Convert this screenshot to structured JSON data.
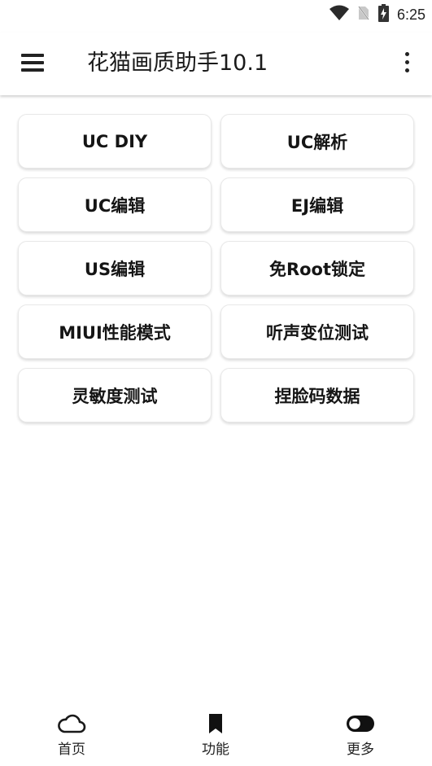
{
  "status_bar": {
    "time": "6:25",
    "icons": [
      "wifi-icon",
      "no-sim-icon",
      "battery-charging-icon"
    ]
  },
  "app_bar": {
    "title": "花猫画质助手10.1",
    "menu_icon": "hamburger-menu-icon",
    "overflow_icon": "more-vertical-icon"
  },
  "buttons": [
    {
      "label": "UC DIY"
    },
    {
      "label": "UC解析"
    },
    {
      "label": "UC编辑"
    },
    {
      "label": "EJ编辑"
    },
    {
      "label": "US编辑"
    },
    {
      "label": "免Root锁定"
    },
    {
      "label": "MIUI性能模式"
    },
    {
      "label": "听声变位测试"
    },
    {
      "label": "灵敏度测试"
    },
    {
      "label": "捏脸码数据"
    }
  ],
  "bottom_nav": {
    "items": [
      {
        "label": "首页",
        "icon": "cloud-icon"
      },
      {
        "label": "功能",
        "icon": "bookmark-icon"
      },
      {
        "label": "更多",
        "icon": "toggle-icon"
      }
    ],
    "selected_index": 1
  }
}
